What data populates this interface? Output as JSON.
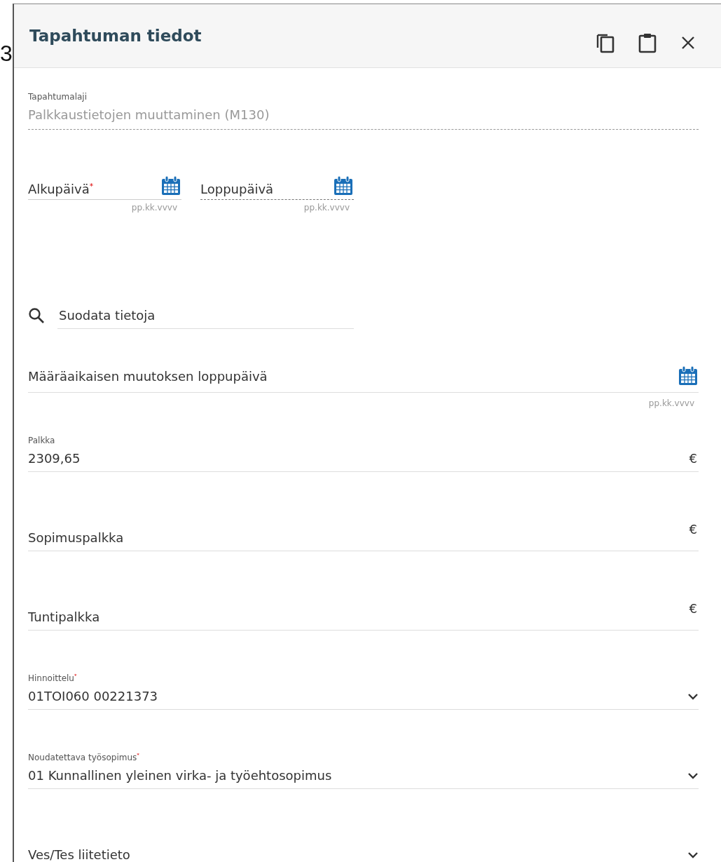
{
  "page_edge": {
    "text": "3"
  },
  "panel": {
    "title": "Tapahtuman tiedot"
  },
  "event_type": {
    "label": "Tapahtumalaji",
    "value": "Palkkaustietojen muuttaminen (M130)"
  },
  "dates": [
    {
      "label": "Alkupäivä$^{*}$",
      "hint": "pp.kk.vvvv",
      "disabled": false
    },
    {
      "label": "Loppupäivä",
      "hint": "pp.kk.vvvv",
      "disabled": true
    }
  ],
  "filter": {
    "placeholder": "Suodata tietoja"
  },
  "fields": [
    {
      "kind": "date",
      "label": "Määräaikaisen muutoksen loppupäivä",
      "hint": "pp.kk.vvvv"
    },
    {
      "kind": "money",
      "label": "Palkka",
      "value": "2309,65",
      "unit": "€"
    },
    {
      "kind": "money",
      "label": "Sopimuspalkka",
      "unit": "€"
    },
    {
      "kind": "money",
      "label": "Tuntipalkka",
      "unit": "€"
    },
    {
      "kind": "select",
      "label": "Hinnoittelu$^{*}$",
      "value": "01TOI060 00221373"
    },
    {
      "kind": "select",
      "label": "Noudatettava työsopimus$^{*}$",
      "value": "01 Kunnallinen yleinen virka- ja työehtosopimus"
    },
    {
      "kind": "select",
      "label": "Ves/Tes liitetieto"
    }
  ]
}
